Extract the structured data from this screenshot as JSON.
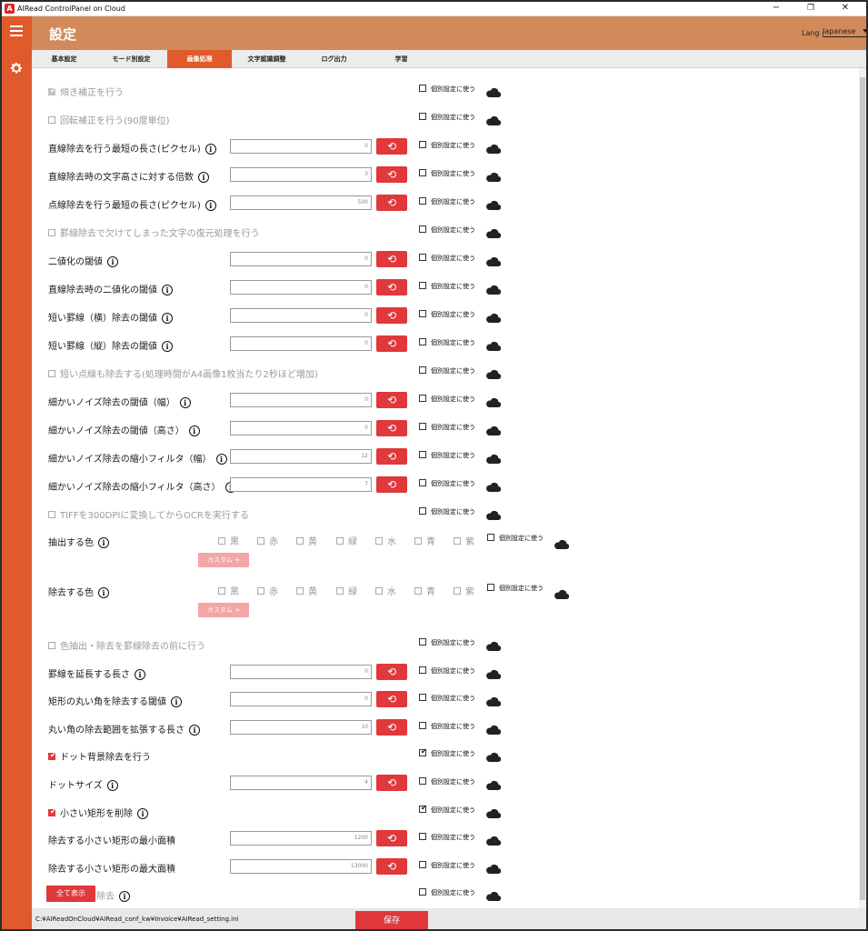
{
  "window": {
    "title": "AIRead ControlPanel on Cloud",
    "minimize": "−",
    "restore": "❐",
    "close": "✕",
    "app_icon": "A"
  },
  "header": {
    "title": "設定",
    "lang_label": "Lang :",
    "lang_value": "Japanese"
  },
  "tabs": [
    {
      "label": "基本設定",
      "active": false
    },
    {
      "label": "モード別設定",
      "active": false
    },
    {
      "label": "画像処理",
      "active": true
    },
    {
      "label": "文字認識調整",
      "active": false
    },
    {
      "label": "ログ出力",
      "active": false
    },
    {
      "label": "学習",
      "active": false
    }
  ],
  "individual_label": "個別設定に使う",
  "reset_icon": "⟲",
  "info_icon": "i",
  "rows": [
    {
      "type": "check",
      "label": "傾き補正を行う",
      "enabled": false,
      "checked": true,
      "indiv": false
    },
    {
      "type": "check",
      "label": "回転補正を行う(90度単位)",
      "enabled": false,
      "checked": false,
      "indiv": false
    },
    {
      "type": "input",
      "label": "直線除去を行う最短の長さ(ピクセル)",
      "value": "0",
      "indiv": false
    },
    {
      "type": "input",
      "label": "直線除去時の文字高さに対する倍数",
      "value": "3",
      "indiv": false
    },
    {
      "type": "input",
      "label": "点線除去を行う最短の長さ(ピクセル)",
      "value": "500",
      "indiv": false
    },
    {
      "type": "check",
      "label": "罫線除去で欠けてしまった文字の復元処理を行う",
      "enabled": false,
      "checked": false,
      "indiv": false
    },
    {
      "type": "input",
      "label": "二値化の閾値",
      "value": "0",
      "indiv": false
    },
    {
      "type": "input",
      "label": "直線除去時の二値化の閾値",
      "value": "0",
      "indiv": false
    },
    {
      "type": "input",
      "label": "短い罫線（横）除去の閾値",
      "value": "0",
      "indiv": false
    },
    {
      "type": "input",
      "label": "短い罫線（縦）除去の閾値",
      "value": "0",
      "indiv": false
    },
    {
      "type": "check",
      "label": "短い点線も除去する(処理時間がA4画像1枚当たり2秒ほど増加)",
      "enabled": false,
      "checked": false,
      "indiv": false
    },
    {
      "type": "input",
      "label": "細かいノイズ除去の閾値（幅）",
      "value": "0",
      "indiv": false
    },
    {
      "type": "input",
      "label": "細かいノイズ除去の閾値（高さ）",
      "value": "0",
      "indiv": false
    },
    {
      "type": "input",
      "label": "細かいノイズ除去の縮小フィルタ（幅）",
      "value": "12",
      "indiv": false
    },
    {
      "type": "input",
      "label": "細かいノイズ除去の縮小フィルタ（高さ）",
      "value": "7",
      "indiv": false
    },
    {
      "type": "check",
      "label": "TIFFを300DPIに変換してからOCRを実行する",
      "enabled": false,
      "checked": false,
      "indiv": false
    }
  ],
  "color_rows": [
    {
      "label": "抽出する色",
      "custom_label": "カスタム +"
    },
    {
      "label": "除去する色",
      "custom_label": "カスタム +"
    }
  ],
  "colors": [
    "黒",
    "赤",
    "黄",
    "緑",
    "水",
    "青",
    "紫"
  ],
  "rows2": [
    {
      "type": "check",
      "label": "色抽出・除去を罫線除去の前に行う",
      "enabled": false,
      "checked": false,
      "indiv": false
    },
    {
      "type": "input",
      "label": "罫線を延長する長さ",
      "value": "0",
      "indiv": false
    },
    {
      "type": "input",
      "label": "矩形の丸い角を除去する閾値",
      "value": "0",
      "indiv": false
    },
    {
      "type": "input",
      "label": "丸い角の除去範囲を拡張する長さ",
      "value": "10",
      "indiv": false
    },
    {
      "type": "check",
      "label": "ドット背景除去を行う",
      "enabled": true,
      "checked": true,
      "indiv": true
    },
    {
      "type": "input",
      "label": "ドットサイズ",
      "value": "4",
      "indiv": false
    },
    {
      "type": "check",
      "label": "小さい矩形を削除",
      "enabled": true,
      "checked": true,
      "indiv": true,
      "info": true
    },
    {
      "type": "input",
      "label": "除去する小さい矩形の最小面積",
      "value": "1200",
      "indiv": false,
      "noinfo": true
    },
    {
      "type": "input",
      "label": "除去する小さい矩形の最大面積",
      "value": "13000",
      "indiv": false,
      "noinfo": true
    },
    {
      "type": "check",
      "label": "斜め線を除去",
      "enabled": false,
      "checked": false,
      "indiv": false,
      "info": true
    }
  ],
  "show_all_label": "全て表示",
  "footer": {
    "path": "C:¥AIReadOnCloud¥AIRead_conf_kw¥Invoice¥AIRead_setting.ini",
    "save_label": "保存"
  }
}
